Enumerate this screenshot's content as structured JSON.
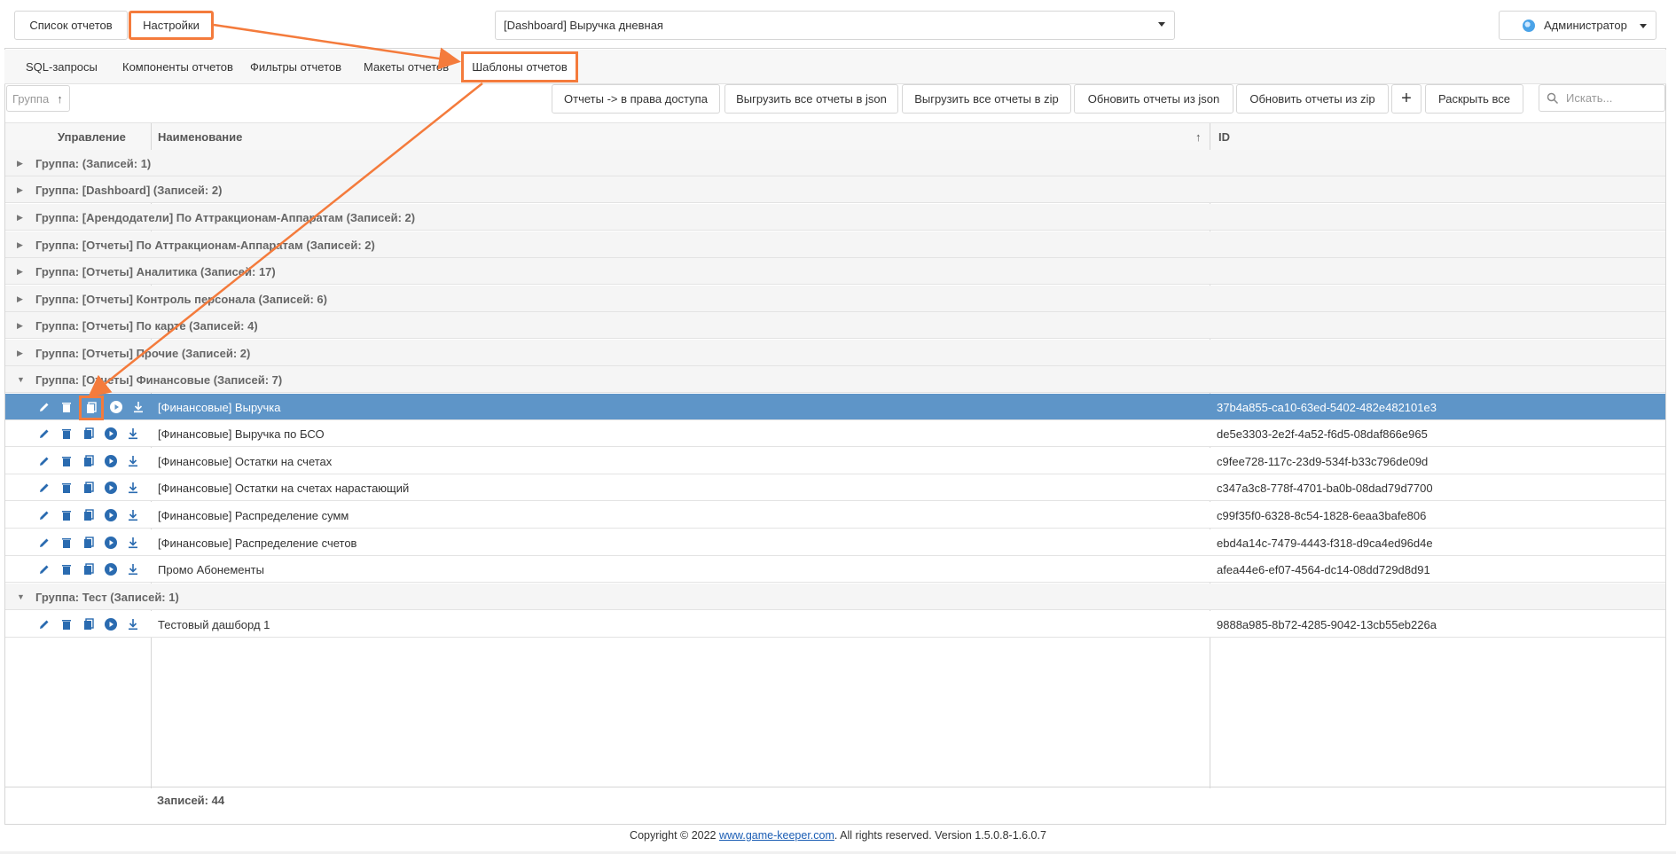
{
  "topnav": {
    "tab_reports": "Список отчетов",
    "tab_settings": "Настройки",
    "report_select_value": "[Dashboard] Выручка дневная",
    "user_label": "Администратор"
  },
  "subtabs": [
    "SQL-запросы",
    "Компоненты отчетов",
    "Фильтры отчетов",
    "Макеты отчетов",
    "Шаблоны отчетов"
  ],
  "toolbar": {
    "group_placeholder": "Группа",
    "btn_rights": "Отчеты -> в права доступа",
    "btn_export_json": "Выгрузить все отчеты в json",
    "btn_export_zip": "Выгрузить все отчеты в zip",
    "btn_update_json": "Обновить отчеты из json",
    "btn_update_zip": "Обновить отчеты из zip",
    "btn_add": "+",
    "btn_expand": "Раскрыть все",
    "search_placeholder": "Искать..."
  },
  "table": {
    "headers": {
      "control": "Управление",
      "name": "Наименование",
      "id": "ID"
    },
    "groups": [
      "Группа: (Записей: 1)",
      "Группа: [Dashboard] (Записей: 2)",
      "Группа: [Арендодатели] По Аттракционам-Аппаратам (Записей: 2)",
      "Группа: [Отчеты] По Аттракционам-Аппаратам (Записей: 2)",
      "Группа: [Отчеты] Аналитика (Записей: 17)",
      "Группа: [Отчеты] Контроль персонала (Записей: 6)",
      "Группа: [Отчеты] По карте (Записей: 4)",
      "Группа: [Отчеты] Прочие (Записей: 2)",
      "Группа: [Отчеты] Финансовые (Записей: 7)",
      "Группа: Тест (Записей: 1)"
    ],
    "financial_rows": [
      {
        "name": "[Финансовые] Выручка",
        "id": "37b4a855-ca10-63ed-5402-482e482101e3"
      },
      {
        "name": "[Финансовые] Выручка по БСО",
        "id": "de5e3303-2e2f-4a52-f6d5-08daf866e965"
      },
      {
        "name": "[Финансовые] Остатки на счетах",
        "id": "c9fee728-117c-23d9-534f-b33c796de09d"
      },
      {
        "name": "[Финансовые] Остатки на счетах нарастающий",
        "id": "c347a3c8-778f-4701-ba0b-08dad79d7700"
      },
      {
        "name": "[Финансовые] Распределение сумм",
        "id": "c99f35f0-6328-8c54-1828-6eaa3bafe806"
      },
      {
        "name": "[Финансовые] Распределение счетов",
        "id": "ebd4a14c-7479-4443-f318-d9ca4ed96d4e"
      },
      {
        "name": "Промо Абонементы",
        "id": "afea44e6-ef07-4564-dc14-08dd729d8d91"
      }
    ],
    "test_rows": [
      {
        "name": "Тестовый дашборд 1",
        "id": "9888a985-8b72-4285-9042-13cb55eb226a"
      }
    ],
    "records_total": "Записей: 44"
  },
  "footer": {
    "copyright_prefix": "Copyright © 2022 ",
    "link": "www.game-keeper.com",
    "copyright_suffix": ". All rights reserved.  Version 1.5.0.8-1.6.0.7"
  },
  "colors": {
    "accent_orange": "#f47b3c",
    "selected_row": "#5e95c8",
    "icon_blue": "#2a6bb0"
  }
}
